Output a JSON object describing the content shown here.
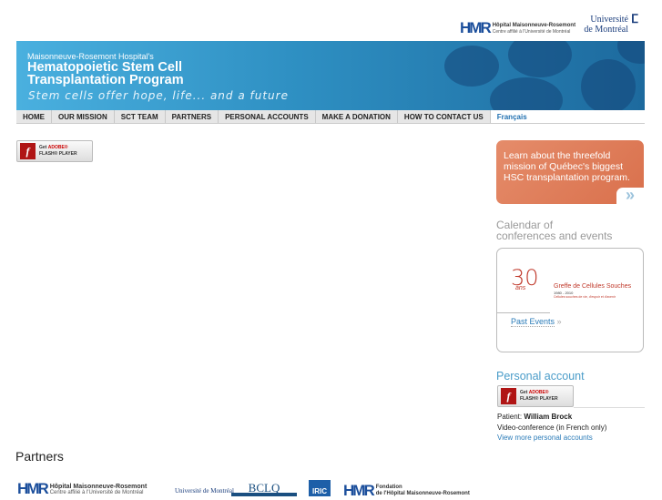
{
  "header": {
    "hmr_logo": "HMR",
    "hmr_name": "Hôpital Maisonneuve-Rosemont",
    "hmr_sub": "Centre affilié à l'Université de Montréal",
    "udem_line1": "Université",
    "udem_line2": "de Montréal"
  },
  "banner": {
    "subtitle": "Maisonneuve-Rosemont Hospital's",
    "title_line1": "Hematopoietic Stem Cell",
    "title_line2": "Transplantation Program",
    "tagline": "Stem cells offer hope, life... and a future"
  },
  "nav": [
    {
      "label": "HOME"
    },
    {
      "label": "OUR MISSION"
    },
    {
      "label": "SCT TEAM"
    },
    {
      "label": "PARTNERS"
    },
    {
      "label": "PERSONAL ACCOUNTS"
    },
    {
      "label": "MAKE A DONATION"
    },
    {
      "label": "HOW TO CONTACT US"
    },
    {
      "label": "Français"
    }
  ],
  "flash": {
    "get": "Get",
    "adobe": "ADOBE®",
    "player": "FLASH® PLAYER"
  },
  "promo": {
    "text": "Learn about the threefold mission of Québec's biggest HSC transplantation program.",
    "arrow": "»"
  },
  "calendar": {
    "heading_line1": "Calendar of",
    "heading_line2": "conferences and events",
    "badge": "30",
    "badge_sub": "ans",
    "event_title": "Greffe de Cellules Souches",
    "event_years": "1980 - 2010",
    "event_tag": "Cellules souches de vie, d'espoir et d'avenir",
    "past_events": "Past Events",
    "past_arrow": "»"
  },
  "personal": {
    "heading": "Personal account",
    "patient_label": "Patient:",
    "patient_name": "William Brock",
    "description": "Video-conference (in French only)",
    "more_link": "View more personal accounts"
  },
  "partners": {
    "heading": "Partners",
    "logos": [
      "Hôpital Maisonneuve-Rosemont",
      "Université de Montréal",
      "BCLQ",
      "IRIC",
      "Fondation de l'Hôpital Maisonneuve-Rosemont"
    ],
    "fondation_line1": "Fondation",
    "fondation_line2": "de l'Hôpital Maisonneuve-Rosemont"
  }
}
